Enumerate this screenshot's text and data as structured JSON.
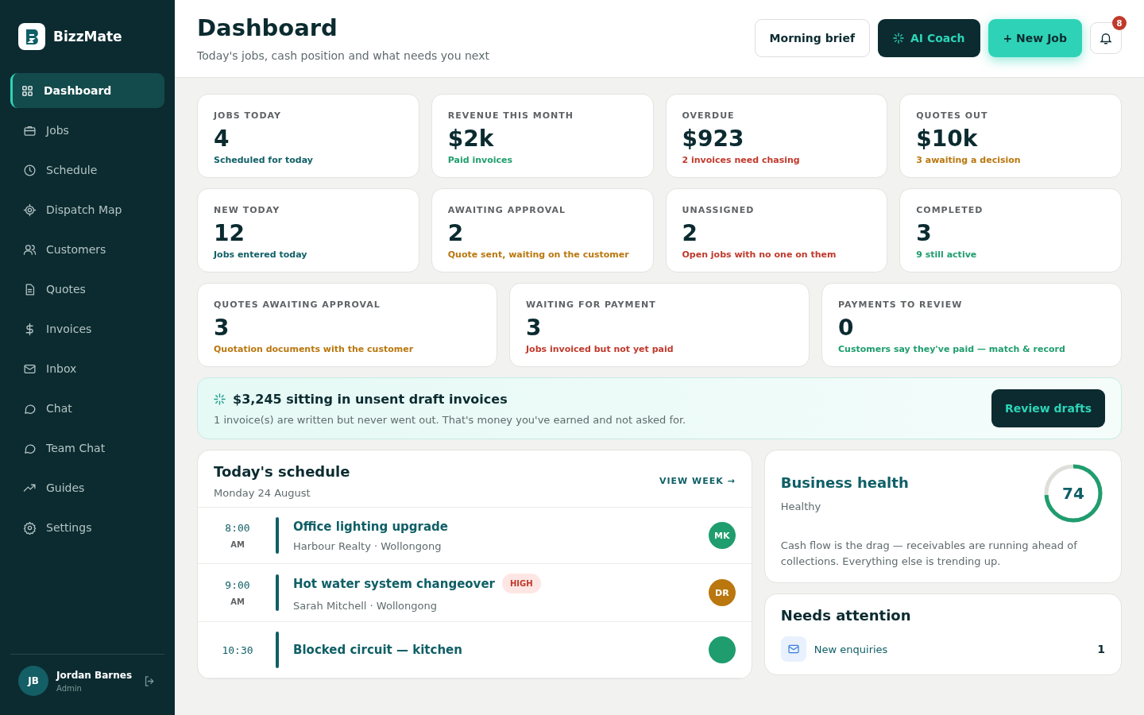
{
  "brand": {
    "name": "BizzMate"
  },
  "nav": [
    {
      "label": "Dashboard",
      "selected": true
    },
    {
      "label": "Jobs",
      "selected": false
    },
    {
      "label": "Schedule",
      "selected": false
    },
    {
      "label": "Dispatch Map",
      "selected": false
    },
    {
      "label": "Customers",
      "selected": false
    },
    {
      "label": "Quotes",
      "selected": false
    },
    {
      "label": "Invoices",
      "selected": false
    },
    {
      "label": "Inbox",
      "selected": false
    },
    {
      "label": "Chat",
      "selected": false
    },
    {
      "label": "Team Chat",
      "selected": false
    },
    {
      "label": "Guides",
      "selected": false
    },
    {
      "label": "Settings",
      "selected": false
    }
  ],
  "user": {
    "initials": "JB",
    "name": "Jordan Barnes",
    "role": "Admin"
  },
  "header": {
    "title": "Dashboard",
    "subtitle": "Today's jobs, cash position and what needs you next",
    "buttons": [
      {
        "label": "Morning brief",
        "kind": "outline"
      },
      {
        "label": "AI Coach",
        "kind": "dark"
      },
      {
        "label": "+ New Job",
        "kind": "primary"
      }
    ],
    "notifications": "8"
  },
  "stats_row_1": [
    {
      "label": "JOBS TODAY",
      "value": "4",
      "note": "Scheduled for today",
      "color": "#0f5f66"
    },
    {
      "label": "REVENUE THIS MONTH",
      "value": "$2k",
      "note": "Paid invoices",
      "color": "#1f9d6e"
    },
    {
      "label": "OVERDUE",
      "value": "$923",
      "note": "2 invoices need chasing",
      "color": "#c0392b"
    },
    {
      "label": "QUOTES OUT",
      "value": "$10k",
      "note": "3 awaiting a decision",
      "color": "#b9770e"
    }
  ],
  "stats_row_2": [
    {
      "label": "NEW TODAY",
      "value": "12",
      "note": "Jobs entered today",
      "color": "#0f5f66"
    },
    {
      "label": "AWAITING APPROVAL",
      "value": "2",
      "note": "Quote sent, waiting on the customer",
      "color": "#b9770e"
    },
    {
      "label": "UNASSIGNED",
      "value": "2",
      "note": "Open jobs with no one on them",
      "color": "#c0392b"
    },
    {
      "label": "COMPLETED",
      "value": "3",
      "note": "9 still active",
      "color": "#1f9d6e"
    }
  ],
  "stats_row_3": [
    {
      "label": "QUOTES AWAITING APPROVAL",
      "value": "3",
      "note": "Quotation documents with the customer",
      "color": "#b9770e"
    },
    {
      "label": "WAITING FOR PAYMENT",
      "value": "3",
      "note": "Jobs invoiced but not yet paid",
      "color": "#c0392b"
    },
    {
      "label": "PAYMENTS TO REVIEW",
      "value": "0",
      "note": "Customers say they've paid — match & record",
      "color": "#1f9d6e"
    }
  ],
  "draft_banner": {
    "title": "$3,245 sitting in unsent draft invoices",
    "text": "1 invoice(s) are written but never went out. That's money you've earned and not asked for.",
    "button": "Review drafts"
  },
  "schedule": {
    "title": "Today's schedule",
    "date": "Monday 24 August",
    "link": "VIEW WEEK →",
    "jobs": [
      {
        "time": "8:00",
        "period": "AM",
        "title": "Office lighting upgrade",
        "detail": "Harbour Realty · Wollongong",
        "initials": "MK",
        "color": "#1f9d6e"
      },
      {
        "time": "9:00",
        "period": "AM",
        "title": "Hot water system changeover",
        "badge": "HIGH",
        "detail": "Sarah Mitchell · Wollongong",
        "initials": "DR",
        "color": "#b9770e"
      },
      {
        "time": "10:30",
        "title": "Blocked circuit — kitchen",
        "color": "#1f9d6e"
      }
    ]
  },
  "health": {
    "title": "Business health",
    "status": "Healthy",
    "score": "74",
    "level": 0.74,
    "text": "Cash flow is the drag — receivables are running ahead of collections. Everything else is trending up."
  },
  "attention": {
    "title": "Needs attention",
    "items": [
      {
        "label": "New enquiries",
        "count": "1"
      }
    ]
  }
}
